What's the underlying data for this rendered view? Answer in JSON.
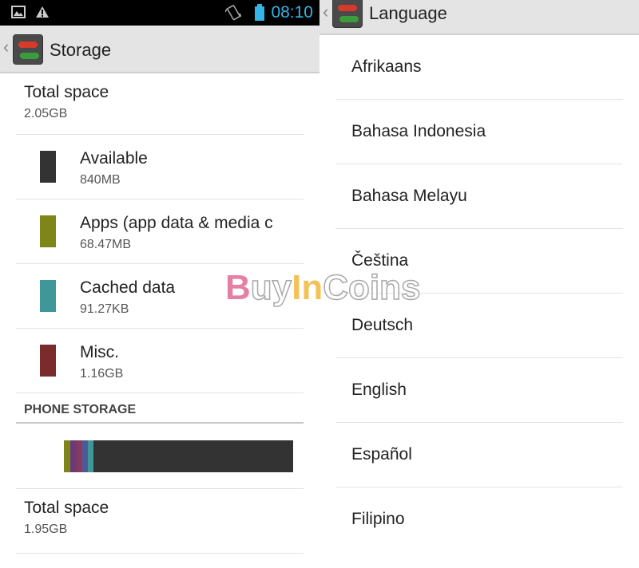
{
  "left": {
    "status_bar": {
      "time": "08:10",
      "icons": [
        "image-icon",
        "warning-icon",
        "vibrate-icon",
        "battery-icon"
      ]
    },
    "action_bar": {
      "title": "Storage"
    },
    "rows": [
      {
        "title": "Total space",
        "value": "2.05GB"
      },
      {
        "title": "Available",
        "value": "840MB",
        "color": "#333333"
      },
      {
        "title": "Apps (app data & media c",
        "value": "68.47MB",
        "color": "#7e861a"
      },
      {
        "title": "Cached data",
        "value": "91.27KB",
        "color": "#3f9797"
      },
      {
        "title": "Misc.",
        "value": "1.16GB",
        "color": "#7a2b2b"
      }
    ],
    "section_header": "PHONE STORAGE",
    "storage_bar_colors": [
      "#7e861a",
      "#6a3a7a",
      "#8a3a5a",
      "#4a5a9a",
      "#3f9797",
      "#333333"
    ],
    "total_row": {
      "title": "Total space",
      "value": "1.95GB"
    }
  },
  "right": {
    "action_bar": {
      "title": "Language"
    },
    "languages": [
      "Afrikaans",
      "Bahasa Indonesia",
      "Bahasa Melayu",
      "Čeština",
      "Deutsch",
      "English",
      "Español",
      "Filipino"
    ]
  },
  "watermark": {
    "part1": "B",
    "part2": "uy",
    "part3": "In",
    "part4": "Coins"
  }
}
